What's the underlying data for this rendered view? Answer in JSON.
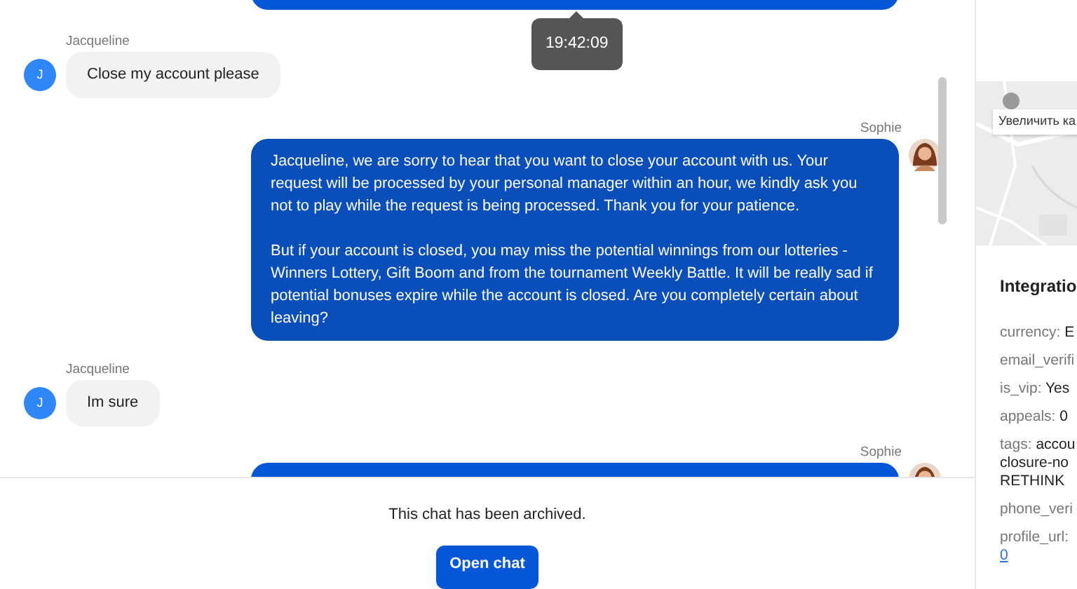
{
  "chat": {
    "top_cut_bubble": true,
    "tooltip": "19:42:09",
    "messages": [
      {
        "kind": "customer",
        "author": "Jacqueline",
        "avatar_letter": "J",
        "paragraphs": [
          "Close my account please"
        ]
      },
      {
        "kind": "agent",
        "author": "Sophie",
        "paragraphs": [
          "Jacqueline, we are sorry to hear that you want to close your account with us. Your request will be processed by your personal manager within an hour, we kindly ask you not to play while the request is being processed. Thank you for your patience.",
          "But if your account is closed, you may miss the potential winnings from our lotteries - Winners Lottery, Gift Boom and from the tournament Weekly Battle. It will be really sad if potential bonuses expire while the account is closed. Are you completely certain about leaving?"
        ]
      },
      {
        "kind": "customer",
        "author": "Jacqueline",
        "avatar_letter": "J",
        "paragraphs": [
          "Im sure"
        ]
      },
      {
        "kind": "agent",
        "author": "Sophie"
      }
    ],
    "footer": {
      "notice": "This chat has been archived.",
      "button": "Open chat"
    }
  },
  "sidebar": {
    "map": {
      "kind": "picture",
      "zoom_button": "Увеличить ка"
    },
    "integrations": {
      "title": "Integratio",
      "fields": [
        {
          "kind": "text",
          "key": "currency:",
          "value": "E"
        },
        {
          "kind": "text",
          "key": "email_verifi"
        },
        {
          "kind": "text",
          "key": "is_vip:",
          "value": "Yes"
        },
        {
          "kind": "text",
          "key": "appeals:",
          "value": "0"
        },
        {
          "kind": "tags",
          "key": "tags:",
          "values": [
            "accou",
            "closure-no",
            "RETHINK"
          ]
        },
        {
          "kind": "text",
          "key": "phone_veri"
        },
        {
          "kind": "link",
          "key": "profile_url:",
          "value": "0"
        }
      ]
    }
  }
}
